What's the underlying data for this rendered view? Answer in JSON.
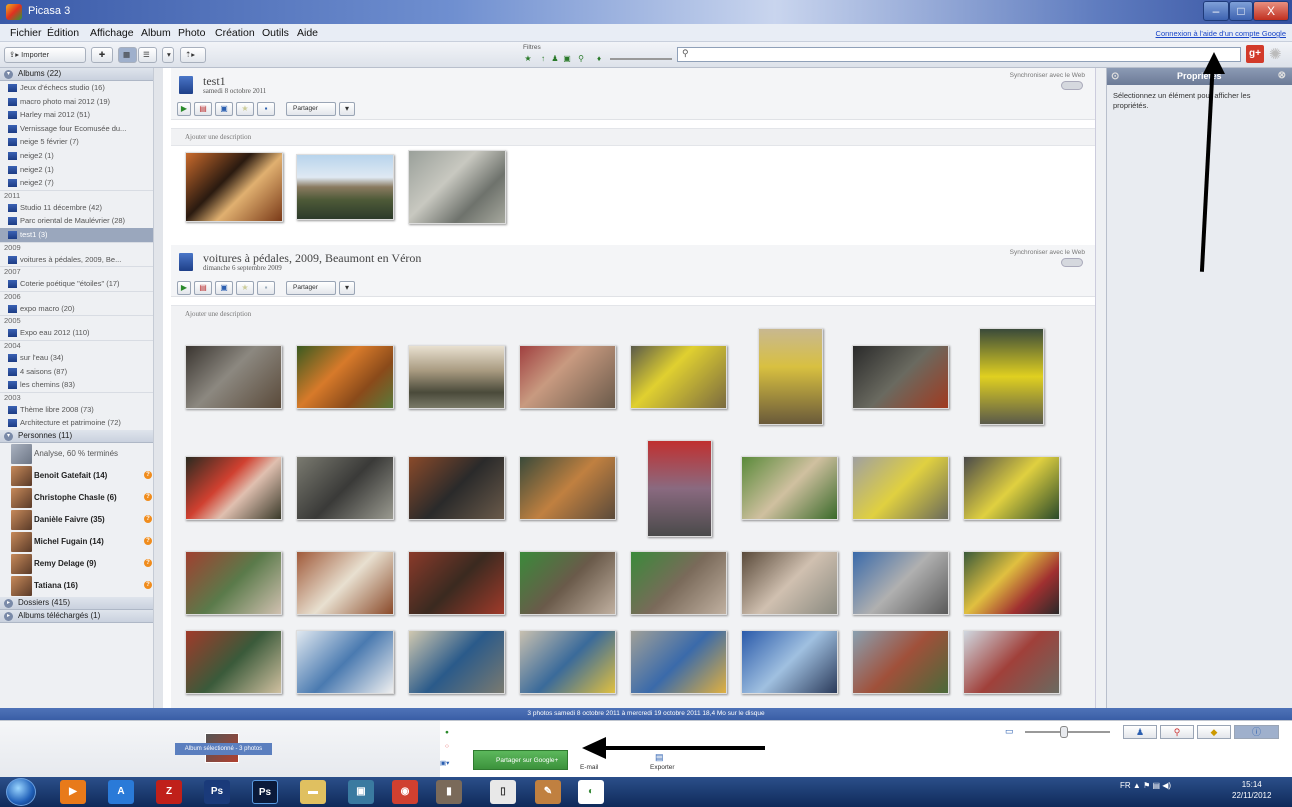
{
  "window": {
    "title": "Picasa 3",
    "min": "–",
    "max": "□",
    "close": "X"
  },
  "menu": [
    "Fichier",
    "Édition",
    "Affichage",
    "Album",
    "Photo",
    "Création",
    "Outils",
    "Aide"
  ],
  "google_link": "Connexion à l'aide d'un compte Google",
  "toolbar": {
    "import_label": "Importer",
    "filters_label": "Filtres",
    "search_value": ""
  },
  "sidebar": {
    "albums_header": "Albums (22)",
    "albums": [
      {
        "label": "Jeux d'échecs studio (16)"
      },
      {
        "label": "macro photo mai 2012 (19)"
      },
      {
        "label": "Harley mai 2012 (51)"
      },
      {
        "label": "Vernissage four Ecomusée du..."
      },
      {
        "label": "neige 5 février (7)"
      },
      {
        "label": "neige2 (1)"
      },
      {
        "label": "neige2 (1)"
      },
      {
        "label": "neige2 (7)"
      }
    ],
    "groups": [
      {
        "year": "2011",
        "items": [
          "Studio 11 décembre (42)",
          "Parc oriental de Maulévrier (28)",
          "test1 (3)"
        ]
      },
      {
        "year": "2009",
        "items": [
          "voitures à pédales, 2009, Be..."
        ]
      },
      {
        "year": "2007",
        "items": [
          "Coterie poétique \"étoiles\" (17)"
        ]
      },
      {
        "year": "2006",
        "items": [
          "expo macro (20)"
        ]
      },
      {
        "year": "2005",
        "items": [
          "Expo eau 2012 (110)"
        ]
      },
      {
        "year": "2004",
        "items": [
          "sur l'eau (34)",
          "4 saisons (87)",
          "les chemins (83)"
        ]
      },
      {
        "year": "2003",
        "items": [
          "Thème libre 2008 (73)",
          "Architecture et patrimoine (72)"
        ]
      }
    ],
    "people_header": "Personnes (11)",
    "people": [
      {
        "name": "Analyse, 60 % terminés"
      },
      {
        "name": "Benoit Gatefait (14)"
      },
      {
        "name": "Christophe Chasle (6)"
      },
      {
        "name": "Danièle Faivre (35)"
      },
      {
        "name": "Michel Fugain (14)"
      },
      {
        "name": "Remy Delage (9)"
      },
      {
        "name": "Tatiana (16)"
      }
    ],
    "folders_header": "Dossiers (415)",
    "downloaded_header": "Albums téléchargés (1)"
  },
  "albums_main": [
    {
      "name": "test1",
      "date": "samedi 8 octobre 2011",
      "sync": "Synchroniser avec le Web",
      "share": "Partager",
      "desc": "Ajouter une description"
    },
    {
      "name": "voitures à pédales, 2009, Beaumont en Véron",
      "date": "dimanche 6 septembre 2009",
      "sync": "Synchroniser avec le Web",
      "share": "Partager",
      "desc": "Ajouter une description"
    }
  ],
  "properties": {
    "title": "Propriétés",
    "text": "Sélectionnez un élément pour afficher les propriétés."
  },
  "status": "3 photos   samedi 8 octobre 2011 à mercredi 19 octobre 2011   18,4 Mo sur le disque",
  "tray": {
    "held": "Album sélectionné - 3 photos",
    "share_gplus": "Partager sur Google+",
    "email": "E-mail",
    "export": "Exporter"
  },
  "taskbar": {
    "lang": "FR",
    "time": "15:14",
    "date": "22/11/2012"
  },
  "colors": {
    "accent": "#3a5ea6",
    "green": "#3c923c"
  }
}
